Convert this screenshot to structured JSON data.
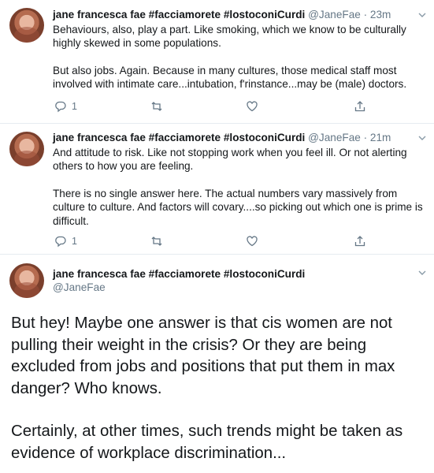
{
  "tweets": [
    {
      "name": "jane francesca fae #facciamorete #lostoconiCurdi",
      "handle": "@JaneFae",
      "time": "· 23m",
      "paragraphs": [
        "Behaviours, also, play a part. Like smoking, which we know to be culturally highly skewed in some populations.",
        "But also jobs. Again. Because in many cultures, those medical staff most involved with intimate care...intubation, f'rinstance...may be (male) doctors."
      ],
      "reply_count": "1"
    },
    {
      "name": "jane francesca fae #facciamorete #lostoconiCurdi",
      "handle": "@JaneFae",
      "time": "· 21m",
      "paragraphs": [
        "And attitude to risk. Like not stopping work when you feel ill. Or not alerting others to how you are feeling.",
        "There is no single answer here. The actual numbers vary massively from culture to culture. And factors will covary....so picking out which one is prime is difficult."
      ],
      "reply_count": "1"
    },
    {
      "name": "jane francesca fae #facciamorete #lostoconiCurdi",
      "handle": "@JaneFae",
      "paragraphs": [
        "But hey! Maybe one answer is that cis women are not pulling their weight in the crisis? Or they are being excluded from jobs and positions that put them in max danger? Who knows.",
        "Certainly, at other times, such trends might be taken as evidence of workplace discrimination..."
      ]
    }
  ]
}
